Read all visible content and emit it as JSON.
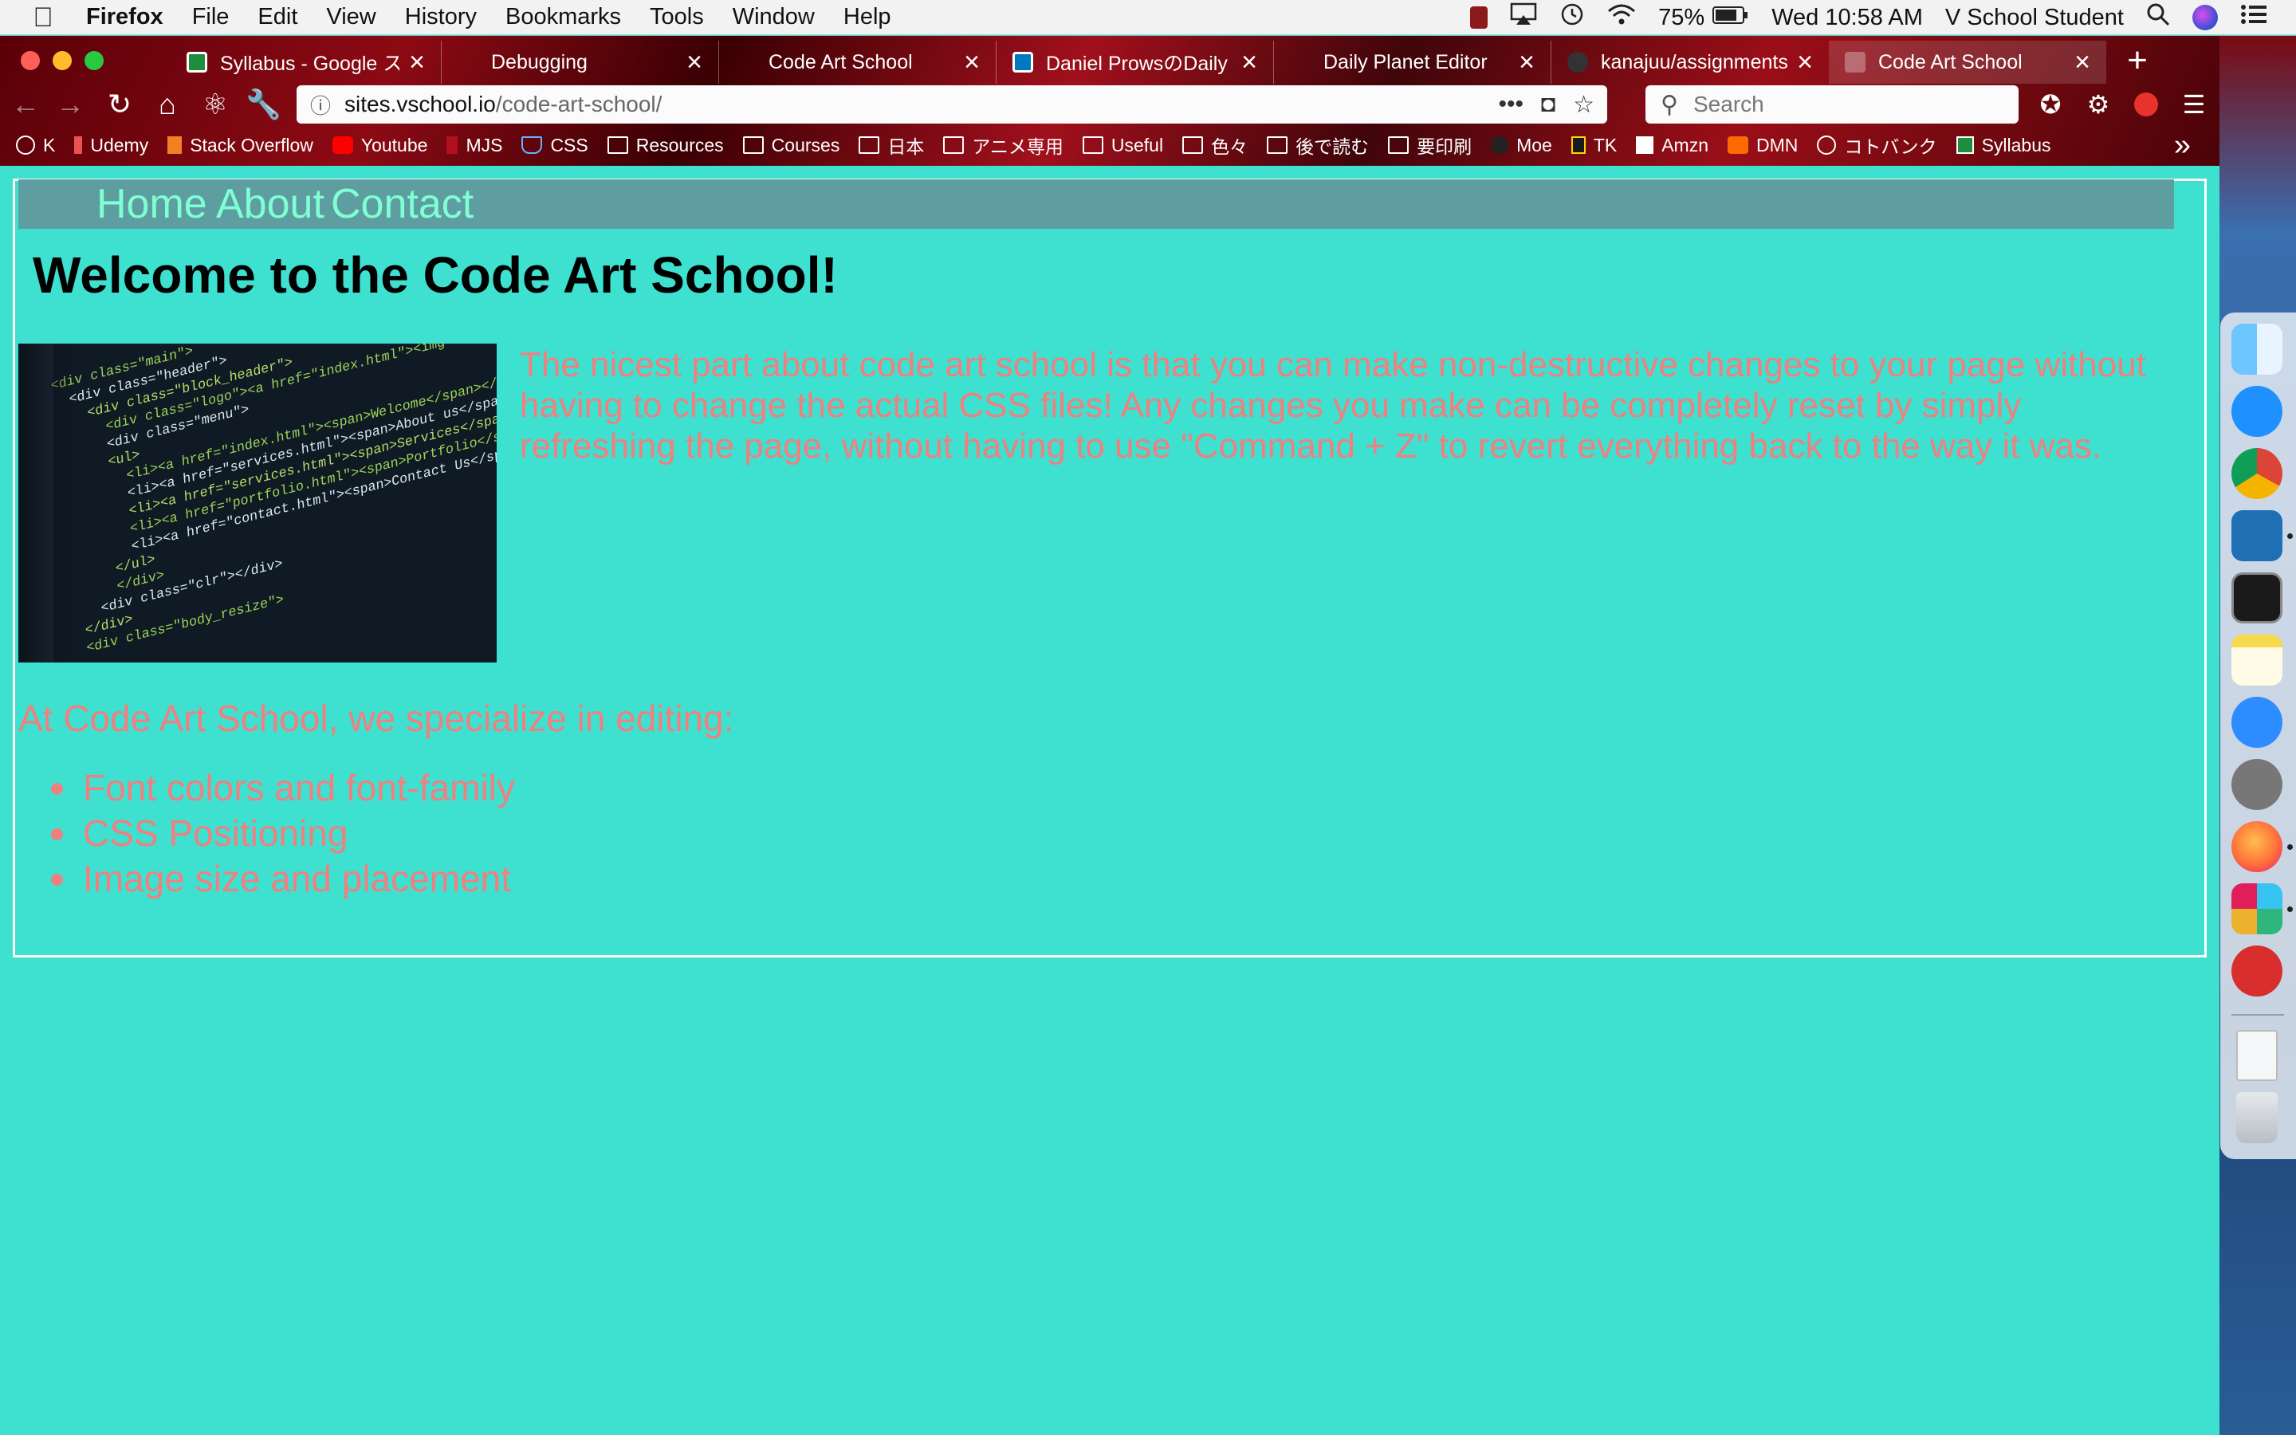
{
  "menubar": {
    "app_name": "Firefox",
    "menus": [
      "File",
      "Edit",
      "View",
      "History",
      "Bookmarks",
      "Tools",
      "Window",
      "Help"
    ],
    "battery": "75%",
    "clock": "Wed 10:58 AM",
    "user": "V School Student"
  },
  "browser": {
    "tabs": [
      {
        "label": "Syllabus - Google ス",
        "icon": "sheets-icon"
      },
      {
        "label": "Debugging",
        "icon": "none"
      },
      {
        "label": "Code Art School",
        "icon": "none"
      },
      {
        "label": "Daniel ProwsのDaily F",
        "icon": "trello-icon"
      },
      {
        "label": "Daily Planet Editor",
        "icon": "none"
      },
      {
        "label": "kanajuu/assignments",
        "icon": "github-icon"
      },
      {
        "label": "Code Art School",
        "icon": "page-icon",
        "active": true
      }
    ],
    "url_host": "sites.vschool.io",
    "url_path": "/code-art-school/",
    "search_placeholder": "Search",
    "bookmarks": [
      "K",
      "Udemy",
      "Stack Overflow",
      "Youtube",
      "MJS",
      "CSS",
      "Resources",
      "Courses",
      "日本",
      "アニメ専用",
      "Useful",
      "色々",
      "後で読む",
      "要印刷",
      "Moe",
      "TK",
      "Amzn",
      "DMN",
      "コトバンク",
      "Syllabus"
    ]
  },
  "site": {
    "nav": [
      "Home",
      "About",
      "Contact"
    ],
    "title": "Welcome to the Code Art School!",
    "intro": "The nicest part about code art school is that you can make non-destructive changes to your page without having to change the actual CSS files! Any changes you make can be completely reset by simply refreshing the page, without having to use \"Command + Z\" to revert everything back to the way it was.",
    "specialize_intro": "At Code Art School, we specialize in editing:",
    "specialties": [
      "Font colors and font-family",
      "CSS Positioning",
      "Image size and placement"
    ],
    "image_code_lines": [
      "<div class=\"main\">",
      "<div class=\"header\">",
      "<div class=\"block_header\">",
      "<div class=\"logo\"><a href=\"index.html\"><img src=\"images/logo.gif\"",
      "<div class=\"menu\">",
      "<ul>",
      "<li><a href=\"index.html\"><span>Welcome</span></a></li>",
      "<li><a href=\"services.html\"><span>About us</span></a></li>",
      "<li><a href=\"services.html\"><span>Services</span></a></li>",
      "<li><a href=\"portfolio.html\"><span>Portfolio</span></a></li>",
      "<li><a href=\"contact.html\"><span>Contact Us</span></a></li>",
      "</ul>",
      "</div>",
      "<div class=\"clr\"></div>",
      "</div>",
      "<div class=\"body_resize\">"
    ]
  },
  "colors": {
    "page_bg": "#3ee0d0",
    "nav_bg": "#5f9ea0",
    "nav_text": "#7fffd4",
    "body_text": "#f08080"
  }
}
